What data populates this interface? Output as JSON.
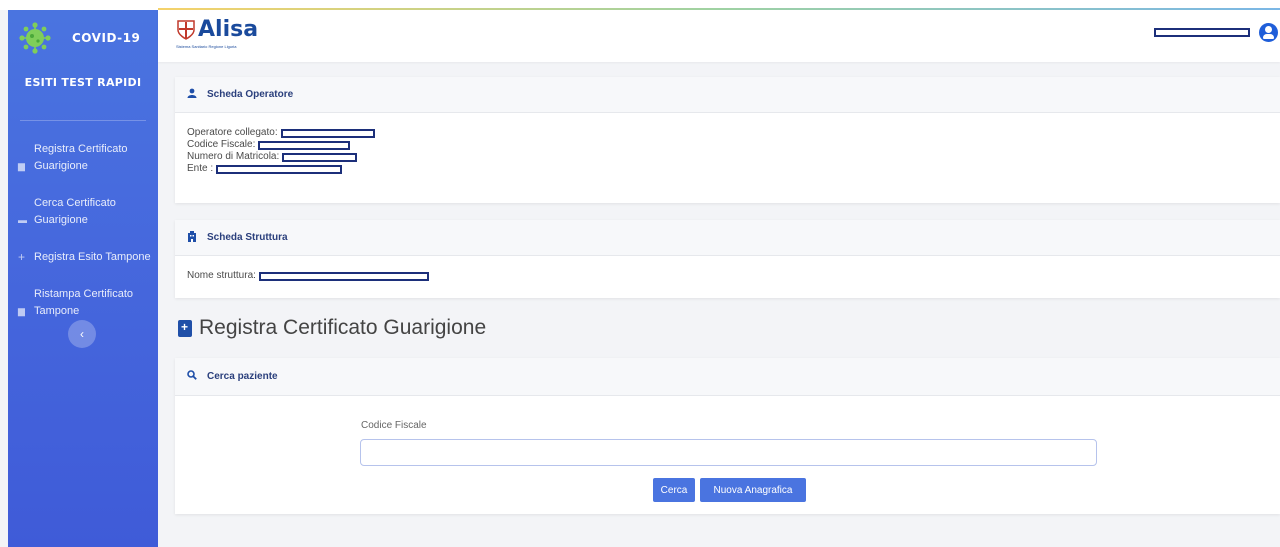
{
  "app": {
    "title": "COVID-19",
    "subtitle": "ESITI TEST RAPIDI"
  },
  "logo": {
    "name": "Alisa",
    "tagline": "Sistema Sanitario Regione Liguria"
  },
  "sidebar": {
    "items": [
      {
        "label_line1": "Registra Certificato",
        "label_line2": "Guarigione",
        "icon": "file-icon"
      },
      {
        "label_line1": "Cerca Certificato",
        "label_line2": "Guarigione",
        "icon": "folder-icon"
      },
      {
        "label_line1": "",
        "label_line2": "Registra Esito Tampone",
        "icon": "plus-icon"
      },
      {
        "label_line1": "Ristampa Certificato",
        "label_line2": "Tampone",
        "icon": "file-icon"
      }
    ],
    "collapse_label": "‹"
  },
  "operator_card": {
    "title": "Scheda Operatore",
    "fields": [
      {
        "label": "Operatore collegato:",
        "value": ""
      },
      {
        "label": "Codice Fiscale:",
        "value": ""
      },
      {
        "label": "Numero di Matricola:",
        "value": ""
      },
      {
        "label": "Ente :",
        "value": ""
      }
    ]
  },
  "structure_card": {
    "title": "Scheda Struttura",
    "fields": [
      {
        "label": "Nome struttura:",
        "value": ""
      }
    ]
  },
  "main": {
    "page_title": "Registra Certificato Guarigione"
  },
  "search_card": {
    "title": "Cerca paziente",
    "field_label": "Codice Fiscale",
    "field_value": "",
    "search_button": "Cerca",
    "new_button": "Nuova Anagrafica"
  },
  "colors": {
    "sidebar": "#4668dd",
    "accent": "#4a74e0",
    "heading": "#2a3f7c"
  }
}
